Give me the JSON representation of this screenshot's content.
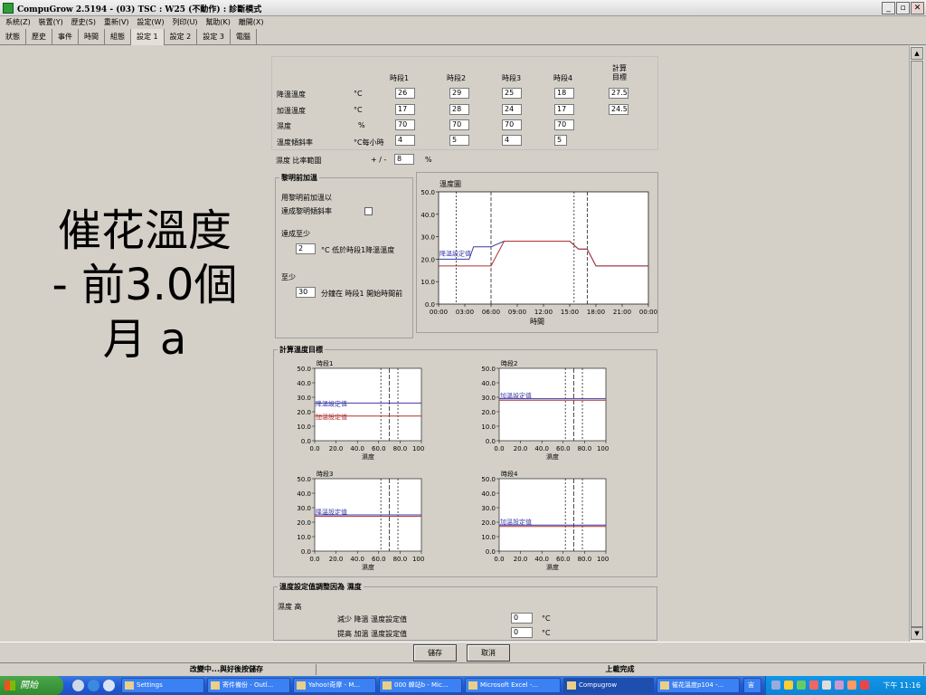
{
  "window": {
    "title": "CompuGrow 2.5194 - (03) TSC : W25 (不動作) : 診斷模式"
  },
  "menu": [
    "系統(Z)",
    "裝置(Y)",
    "歷史(S)",
    "重新(V)",
    "設定(W)",
    "列印(U)",
    "幫助(K)",
    "離開(X)"
  ],
  "tabs": [
    {
      "label": "狀態",
      "active": false
    },
    {
      "label": "歷史",
      "active": false
    },
    {
      "label": "事件",
      "active": false
    },
    {
      "label": "時間",
      "active": false
    },
    {
      "label": "組態",
      "active": false
    },
    {
      "label": "設定 1",
      "active": true
    },
    {
      "label": "設定 2",
      "active": false
    },
    {
      "label": "設定 3",
      "active": false
    },
    {
      "label": "電腦",
      "active": false
    }
  ],
  "overlay": {
    "line1": "催花溫度",
    "line2": "- 前3.0個",
    "line3": "月 a"
  },
  "settings": {
    "headers": [
      "時段1",
      "時段2",
      "時段3",
      "時段4"
    ],
    "calc_header": "計算\n目標",
    "rows": [
      {
        "label": "降溫溫度",
        "unit": "°C",
        "values": [
          "26",
          "29",
          "25",
          "18"
        ],
        "calc": "27.5"
      },
      {
        "label": "加溫溫度",
        "unit": "°C",
        "values": [
          "17",
          "28",
          "24",
          "17"
        ],
        "calc": "24.5"
      },
      {
        "label": "濕度",
        "unit": "%",
        "values": [
          "70",
          "70",
          "70",
          "70"
        ],
        "calc": ""
      },
      {
        "label": "溫度傾斜率",
        "unit": "°C每小時",
        "values": [
          "4",
          "5",
          "4",
          "5"
        ],
        "calc": ""
      }
    ],
    "range_label": "濕度 比率範圍",
    "range_sign": "+ / -",
    "range_value": "8",
    "range_unit": "%"
  },
  "dawn": {
    "title": "黎明前加溫",
    "line1": "用黎明前加溫以",
    "line2": "達成黎明傾斜率",
    "reach_label": "達成至少",
    "reach_value": "2",
    "reach_text": "°C 低於時段1降溫溫度",
    "atleast_label": "至少",
    "atleast_value": "30",
    "atleast_text": "分鐘在 時段1 開始時間前"
  },
  "temp_chart": {
    "title": "溫度圖",
    "xlabel": "時間",
    "y_ticks": [
      "50.0",
      "40.0",
      "30.0",
      "20.0",
      "10.0",
      "0.0"
    ],
    "x_ticks": [
      "00:00",
      "03:00",
      "06:00",
      "09:00",
      "12:00",
      "15:00",
      "18:00",
      "21:00",
      "00:00"
    ],
    "label": "降溫設定值"
  },
  "calc_section": {
    "title": "計算溫度目標"
  },
  "mini_charts": [
    {
      "title": "時段1",
      "labels": [
        "降溫設定值",
        "加溫設定值"
      ],
      "xlabel": "濕度"
    },
    {
      "title": "時段2",
      "labels": [
        "加溫設定值"
      ],
      "xlabel": "濕度"
    },
    {
      "title": "時段3",
      "labels": [
        "降溫設定值"
      ],
      "xlabel": "濕度"
    },
    {
      "title": "時段4",
      "labels": [
        "加溫設定值"
      ],
      "xlabel": "濕度"
    }
  ],
  "mini_axis": {
    "y_ticks": [
      "50.0",
      "40.0",
      "30.0",
      "20.0",
      "10.0",
      "0.0"
    ],
    "x_ticks": [
      "0.0",
      "20.0",
      "40.0",
      "60.0",
      "80.0",
      "100.0"
    ]
  },
  "adjust": {
    "title": "溫度設定值調整因為 濕度",
    "subtitle": "濕度 高",
    "row1_label": "減少 降溫 溫度設定值",
    "row1_value": "0",
    "row2_label": "提高 加溫 溫度設定值",
    "row2_value": "0",
    "unit": "°C"
  },
  "buttons": {
    "save": "儲存",
    "cancel": "取消"
  },
  "status": {
    "left": "改變中...與好後按儲存",
    "right": "上載完成"
  },
  "taskbar": {
    "start": "開始",
    "tasks": [
      {
        "label": "Settings",
        "active": false
      },
      {
        "label": "寄件備份 - Outl...",
        "active": false
      },
      {
        "label": "Yahoo!奇摩 - M...",
        "active": false
      },
      {
        "label": "000 韓站b - Mic...",
        "active": false
      },
      {
        "label": "Microsoft Excel -...",
        "active": false
      },
      {
        "label": "Compugrow",
        "active": true
      },
      {
        "label": "催花溫度p104 -...",
        "active": false
      }
    ],
    "clock": "下午 11:16",
    "ime": "宙"
  },
  "chart_data": [
    {
      "type": "line",
      "title": "溫度圖",
      "xlabel": "時間",
      "x_ticks": [
        "00:00",
        "03:00",
        "06:00",
        "09:00",
        "12:00",
        "15:00",
        "18:00",
        "21:00",
        "00:00"
      ],
      "ylim": [
        0,
        50
      ],
      "series": [
        {
          "color": "#3a3aa8",
          "values": [
            [
              0,
              20
            ],
            [
              3.5,
              20
            ],
            [
              4,
              25.5
            ],
            [
              6,
              25.5
            ],
            [
              7.5,
              28
            ],
            [
              15,
              28
            ],
            [
              16,
              24.5
            ],
            [
              17,
              24.5
            ],
            [
              18,
              17
            ],
            [
              24,
              17
            ]
          ]
        },
        {
          "color": "#b03030",
          "values": [
            [
              0,
              17
            ],
            [
              6,
              17
            ],
            [
              7.5,
              28
            ],
            [
              15,
              28
            ],
            [
              16,
              24.5
            ],
            [
              17,
              24.5
            ],
            [
              18,
              17
            ],
            [
              24,
              17
            ]
          ]
        }
      ],
      "markers": [
        2,
        6,
        15.5,
        17
      ]
    },
    {
      "type": "line",
      "title": "時段1",
      "xlabel": "濕度",
      "ylim": [
        0,
        50
      ],
      "xlim": [
        0,
        100
      ],
      "series": [
        {
          "color": "#3a3aa8",
          "values": [
            [
              0,
              26
            ],
            [
              100,
              26
            ]
          ]
        },
        {
          "color": "#b03030",
          "values": [
            [
              0,
              17
            ],
            [
              100,
              17
            ]
          ]
        }
      ],
      "markers": [
        62,
        70,
        78
      ]
    },
    {
      "type": "line",
      "title": "時段2",
      "xlabel": "濕度",
      "ylim": [
        0,
        50
      ],
      "xlim": [
        0,
        100
      ],
      "series": [
        {
          "color": "#3a3aa8",
          "values": [
            [
              0,
              29
            ],
            [
              100,
              29
            ]
          ]
        },
        {
          "color": "#b03030",
          "values": [
            [
              0,
              28
            ],
            [
              100,
              28
            ]
          ]
        }
      ],
      "markers": [
        62,
        70,
        78
      ]
    },
    {
      "type": "line",
      "title": "時段3",
      "xlabel": "濕度",
      "ylim": [
        0,
        50
      ],
      "xlim": [
        0,
        100
      ],
      "series": [
        {
          "color": "#3a3aa8",
          "values": [
            [
              0,
              25
            ],
            [
              100,
              25
            ]
          ]
        },
        {
          "color": "#b03030",
          "values": [
            [
              0,
              24
            ],
            [
              100,
              24
            ]
          ]
        }
      ],
      "markers": [
        62,
        70,
        78
      ]
    },
    {
      "type": "line",
      "title": "時段4",
      "xlabel": "濕度",
      "ylim": [
        0,
        50
      ],
      "xlim": [
        0,
        100
      ],
      "series": [
        {
          "color": "#3a3aa8",
          "values": [
            [
              0,
              18
            ],
            [
              100,
              18
            ]
          ]
        },
        {
          "color": "#b03030",
          "values": [
            [
              0,
              17
            ],
            [
              100,
              17
            ]
          ]
        }
      ],
      "markers": [
        62,
        70,
        78
      ]
    }
  ]
}
